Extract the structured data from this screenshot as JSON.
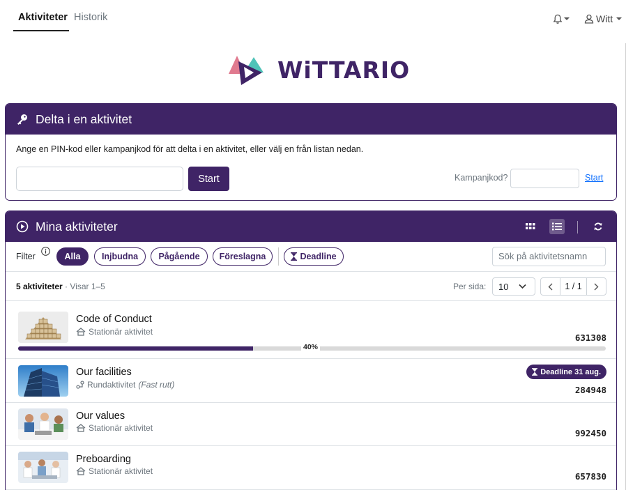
{
  "nav": {
    "tabs": [
      {
        "label": "Aktiviteter",
        "active": true
      },
      {
        "label": "Historik",
        "active": false
      }
    ],
    "user_label": "Witt"
  },
  "logo": {
    "text": "WiTTARIO"
  },
  "delta_card": {
    "title": "Delta i en aktivitet",
    "description": "Ange en PIN-kod eller kampanjkod för att delta i en aktivitet, eller välj en från listan nedan.",
    "pin_value": "",
    "start_label": "Start",
    "kampanj_label": "Kampanjkod?",
    "kampanj_value": "",
    "kampanj_link": "Start"
  },
  "activities_card": {
    "title": "Mina aktiviteter",
    "filter_label": "Filter",
    "filters": [
      "Alla",
      "Injbudna",
      "Pågående",
      "Föreslagna"
    ],
    "filter_deadline": "Deadline",
    "search_placeholder": "Sök på aktivitetsnamn",
    "count_bold": "5 aktiviteter",
    "count_muted": " · Visar 1–5",
    "per_page_label": "Per sida:",
    "per_page_value": "10",
    "page_indicator": "1 / 1",
    "items": [
      {
        "title": "Code of Conduct",
        "type": "Stationär aktivitet",
        "type_note": "",
        "code": "631308",
        "progress": 0.4,
        "progress_label": "40%",
        "deadline": ""
      },
      {
        "title": "Our facilities",
        "type": "Rundaktivitet",
        "type_note": "(Fast rutt)",
        "code": "284948",
        "progress": null,
        "progress_label": "",
        "deadline": "Deadline 31 aug."
      },
      {
        "title": "Our values",
        "type": "Stationär aktivitet",
        "type_note": "",
        "code": "992450",
        "progress": null,
        "progress_label": "",
        "deadline": ""
      },
      {
        "title": "Preboarding",
        "type": "Stationär aktivitet",
        "type_note": "",
        "code": "657830",
        "progress": null,
        "progress_label": "",
        "deadline": ""
      }
    ]
  },
  "colors": {
    "brand": "#3f2466",
    "link": "#0d6efd"
  }
}
